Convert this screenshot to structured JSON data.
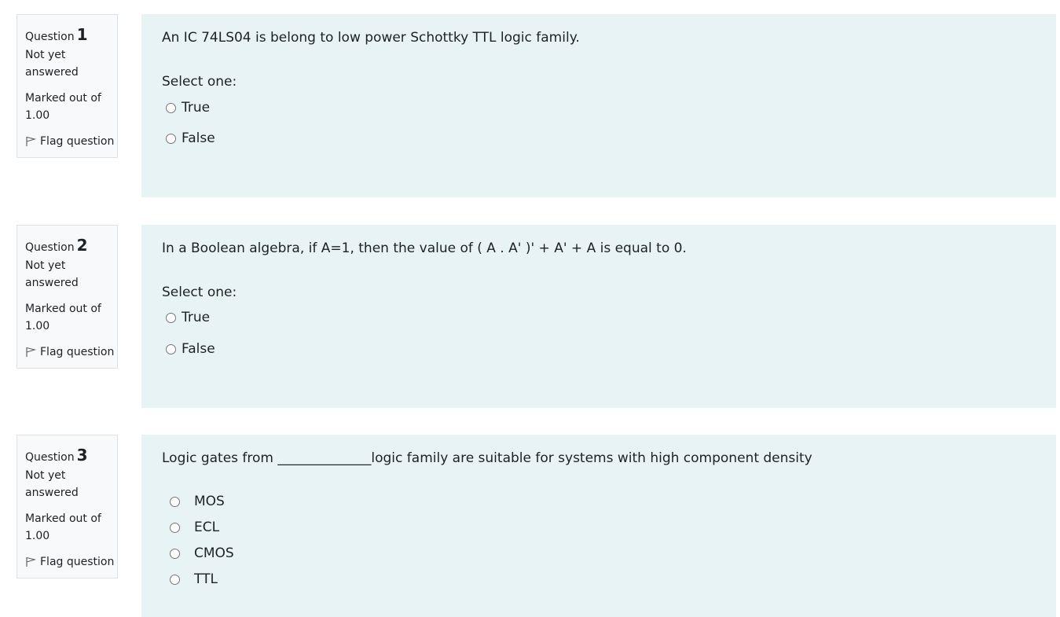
{
  "questions": [
    {
      "word": "Question",
      "number": "1",
      "state": "Not yet answered",
      "grade": "Marked out of 1.00",
      "flag_label": "Flag question",
      "text": "An IC 74LS04 is belong to low power Schottky TTL logic family.",
      "prompt": "Select one:",
      "options": [
        "True",
        "False"
      ]
    },
    {
      "word": "Question",
      "number": "2",
      "state": "Not yet answered",
      "grade": "Marked out of 1.00",
      "flag_label": "Flag question",
      "text": "In a Boolean algebra, if A=1, then the value of ( A . A' )' + A' + A is equal to 0.",
      "prompt": "Select one:",
      "options": [
        "True",
        "False"
      ]
    },
    {
      "word": "Question",
      "number": "3",
      "state": "Not yet answered",
      "grade": "Marked out of 1.00",
      "flag_label": "Flag question",
      "text": "Logic gates from ______________logic family  are suitable for systems with high component density",
      "options": [
        "MOS",
        "ECL",
        "CMOS",
        "TTL"
      ]
    }
  ]
}
